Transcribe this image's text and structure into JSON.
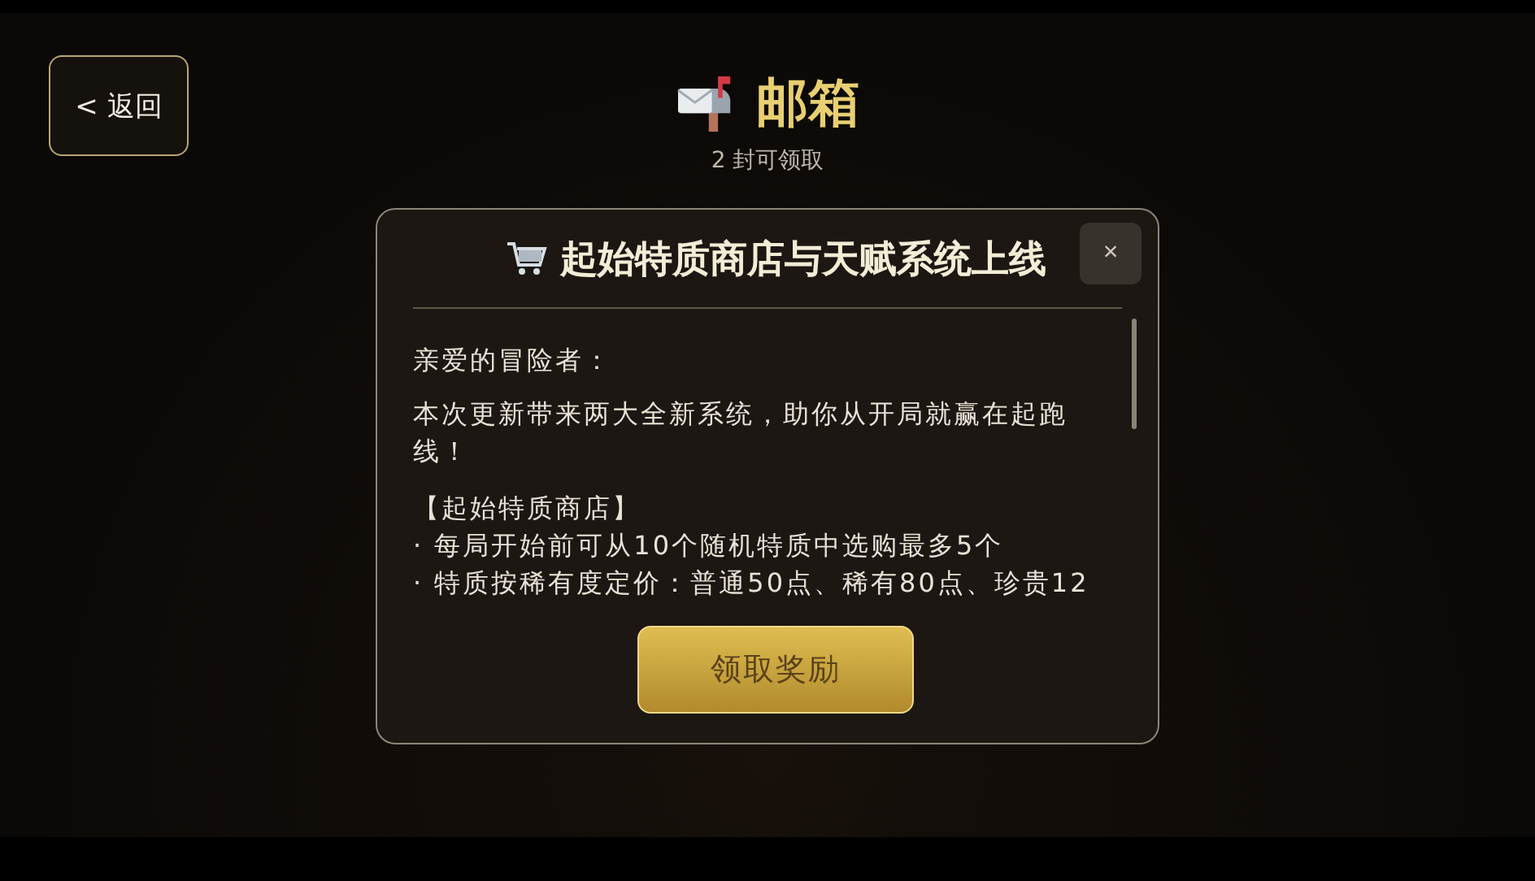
{
  "header": {
    "back_button": "< 返回",
    "title": "邮箱",
    "subtitle": "2 封可领取"
  },
  "mail": {
    "title": "起始特质商店与天赋系统上线",
    "close": "×",
    "greeting": "亲爱的冒险者：",
    "intro": "本次更新带来两大全新系统，助你从开局就赢在起跑线！",
    "section_title": "【起始特质商店】",
    "bullets": [
      {
        "marker": "·",
        "text": "每局开始前可从10个随机特质中选购最多5个"
      },
      {
        "marker": "·",
        "text": "特质按稀有度定价：普通50点、稀有80点、珍贵12"
      }
    ],
    "claim_button": "领取奖励"
  }
}
